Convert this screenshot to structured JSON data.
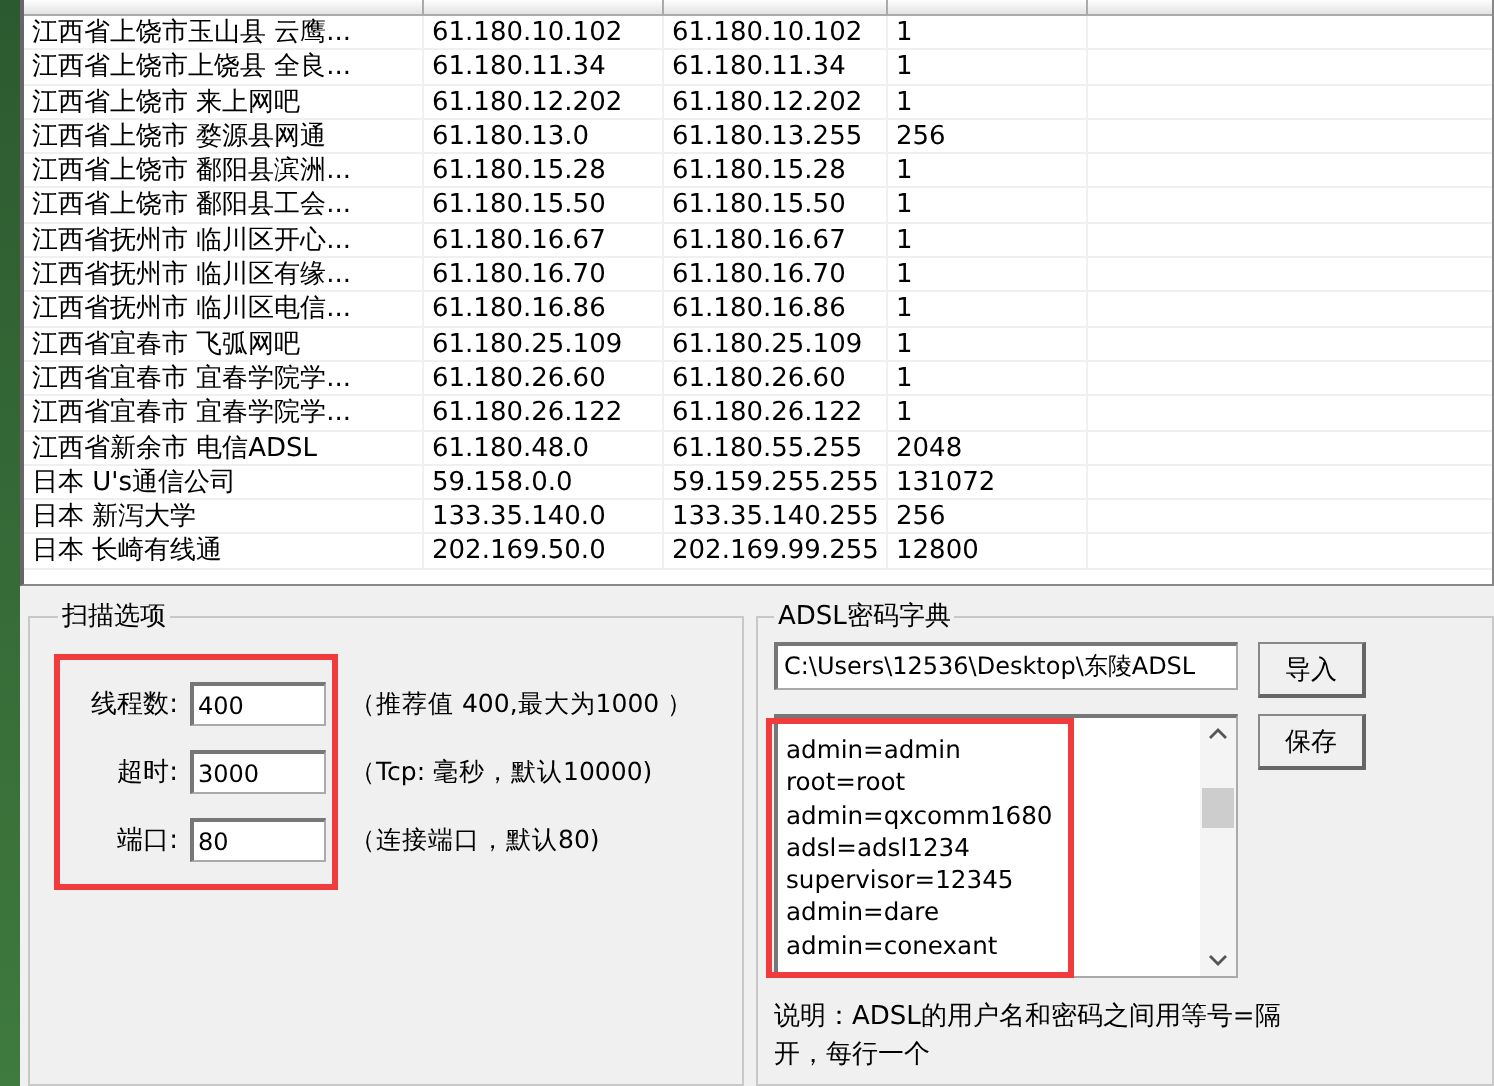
{
  "ip_table": {
    "rows": [
      {
        "location": "江西省上饶市玉山县 云鹰...",
        "start_ip": "61.180.10.102",
        "end_ip": "61.180.10.102",
        "count": "1"
      },
      {
        "location": "江西省上饶市上饶县 全良...",
        "start_ip": "61.180.11.34",
        "end_ip": "61.180.11.34",
        "count": "1"
      },
      {
        "location": "江西省上饶市 来上网吧",
        "start_ip": "61.180.12.202",
        "end_ip": "61.180.12.202",
        "count": "1"
      },
      {
        "location": "江西省上饶市 婺源县网通",
        "start_ip": "61.180.13.0",
        "end_ip": "61.180.13.255",
        "count": "256"
      },
      {
        "location": "江西省上饶市 鄱阳县滨洲...",
        "start_ip": "61.180.15.28",
        "end_ip": "61.180.15.28",
        "count": "1"
      },
      {
        "location": "江西省上饶市 鄱阳县工会...",
        "start_ip": "61.180.15.50",
        "end_ip": "61.180.15.50",
        "count": "1"
      },
      {
        "location": "江西省抚州市 临川区开心...",
        "start_ip": "61.180.16.67",
        "end_ip": "61.180.16.67",
        "count": "1"
      },
      {
        "location": "江西省抚州市 临川区有缘...",
        "start_ip": "61.180.16.70",
        "end_ip": "61.180.16.70",
        "count": "1"
      },
      {
        "location": "江西省抚州市 临川区电信...",
        "start_ip": "61.180.16.86",
        "end_ip": "61.180.16.86",
        "count": "1"
      },
      {
        "location": "江西省宜春市 飞弧网吧",
        "start_ip": "61.180.25.109",
        "end_ip": "61.180.25.109",
        "count": "1"
      },
      {
        "location": "江西省宜春市 宜春学院学...",
        "start_ip": "61.180.26.60",
        "end_ip": "61.180.26.60",
        "count": "1"
      },
      {
        "location": "江西省宜春市 宜春学院学...",
        "start_ip": "61.180.26.122",
        "end_ip": "61.180.26.122",
        "count": "1"
      },
      {
        "location": "江西省新余市 电信ADSL",
        "start_ip": "61.180.48.0",
        "end_ip": "61.180.55.255",
        "count": "2048"
      },
      {
        "location": "日本 U's通信公司",
        "start_ip": "59.158.0.0",
        "end_ip": "59.159.255.255",
        "count": "131072"
      },
      {
        "location": "日本 新泻大学",
        "start_ip": "133.35.140.0",
        "end_ip": "133.35.140.255",
        "count": "256"
      },
      {
        "location": "日本 长崎有线通",
        "start_ip": "202.169.50.0",
        "end_ip": "202.169.99.255",
        "count": "12800"
      }
    ]
  },
  "scan_options": {
    "title": "扫描选项",
    "fields": [
      {
        "label": "线程数:",
        "value": "400",
        "hint": "（推荐值 400,最大为1000 ）"
      },
      {
        "label": "超时:",
        "value": "3000",
        "hint": "（Tcp: 毫秒，默认10000)"
      },
      {
        "label": "端口:",
        "value": "80",
        "hint": "（连接端口，默认80)"
      }
    ]
  },
  "dictionary": {
    "title": "ADSL密码字典",
    "path": "C:\\Users\\12536\\Desktop\\东陵ADSL",
    "import_button": "导入",
    "save_button": "保存",
    "entries": [
      "admin=admin",
      "root=root",
      "admin=qxcomm1680",
      "adsl=adsl1234",
      "supervisor=12345",
      "admin=dare",
      "admin=conexant"
    ],
    "note": "说明：ADSL的用户名和密码之间用等号=隔开，每行一个"
  }
}
